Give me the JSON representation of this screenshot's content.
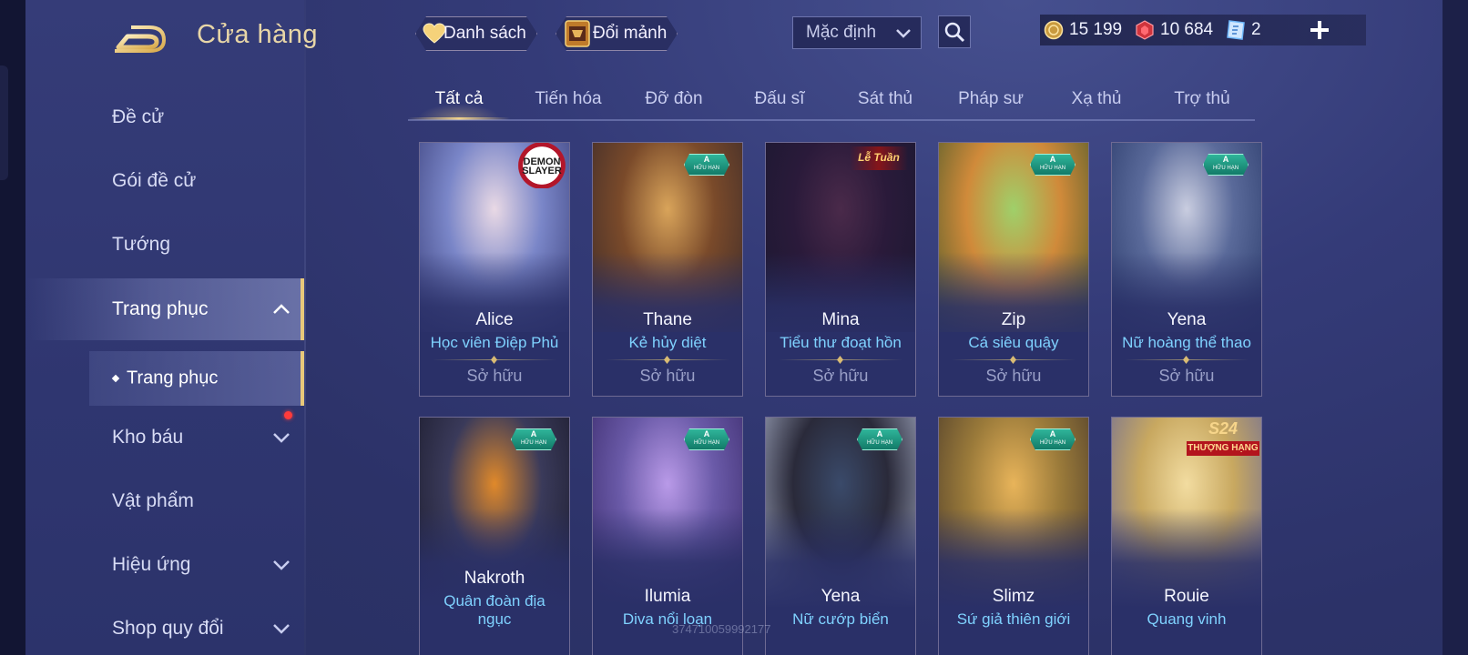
{
  "header": {
    "title": "Cửa hàng",
    "wishlist_label": "Danh sách",
    "exchange_label": "Đổi mảnh",
    "sort_selected": "Mặc định"
  },
  "currencies": [
    {
      "icon": "gold-coin-icon",
      "value": "15 199"
    },
    {
      "icon": "red-gem-icon",
      "value": "10 684"
    },
    {
      "icon": "voucher-icon",
      "value": "2"
    }
  ],
  "sidebar": {
    "items": [
      {
        "label": "Đề cử"
      },
      {
        "label": "Gói đề cử"
      },
      {
        "label": "Tướng"
      },
      {
        "label": "Trang phục"
      },
      {
        "label": "Kho báu"
      },
      {
        "label": "Vật phẩm"
      },
      {
        "label": "Hiệu ứng"
      },
      {
        "label": "Shop quy đổi"
      }
    ],
    "sub_item": "Trang phục"
  },
  "tabs": [
    "Tất cả",
    "Tiến hóa",
    "Đỡ đòn",
    "Đấu sĩ",
    "Sát thủ",
    "Pháp sư",
    "Xạ thủ",
    "Trợ thủ"
  ],
  "badges": {
    "limited_grade": "A",
    "limited_text": "HỮU HẠN",
    "demon_slayer": "DEMON SLAYER",
    "event_red": "Lễ Tuần",
    "s24_big": "S24",
    "s24_small": "THƯỢNG HẠNG"
  },
  "cards": [
    {
      "hero": "Alice",
      "skin": "Học viên Điệp Phủ",
      "status": "Sở hữu",
      "badge": "demon-slayer",
      "palette": [
        "#e9d9e5",
        "#7a86c8",
        "#3a3f7a"
      ]
    },
    {
      "hero": "Thane",
      "skin": "Kẻ hủy diệt",
      "status": "Sở hữu",
      "badge": "limited",
      "palette": [
        "#d9a45a",
        "#7a4a2a",
        "#3a2a2a"
      ]
    },
    {
      "hero": "Mina",
      "skin": "Tiểu thư đoạt hồn",
      "status": "Sở hữu",
      "badge": "event-red",
      "palette": [
        "#4a2a4a",
        "#2a1a3a",
        "#1a1830"
      ]
    },
    {
      "hero": "Zip",
      "skin": "Cá siêu quậy",
      "status": "Sở hữu",
      "badge": "limited",
      "palette": [
        "#9fd06a",
        "#d08a3a",
        "#4a5a2a"
      ]
    },
    {
      "hero": "Yena",
      "skin": "Nữ hoàng thể thao",
      "status": "Sở hữu",
      "badge": "limited",
      "palette": [
        "#c9cde0",
        "#5a6a9a",
        "#2a3a6a"
      ]
    },
    {
      "hero": "Nakroth",
      "skin": "Quân đoàn địa ngục",
      "status": "",
      "badge": "limited",
      "palette": [
        "#e0892a",
        "#3a3a5a",
        "#1a1a2a"
      ]
    },
    {
      "hero": "Ilumia",
      "skin": "Diva nổi loạn",
      "status": "",
      "badge": "limited",
      "palette": [
        "#b99ae8",
        "#6a5aa8",
        "#3a2a6a"
      ]
    },
    {
      "hero": "Yena",
      "skin": "Nữ cướp biển",
      "status": "",
      "badge": "limited",
      "palette": [
        "#3a4a6a",
        "#2a2a3a",
        "#a8b0c8"
      ]
    },
    {
      "hero": "Slimz",
      "skin": "Sứ giả thiên giới",
      "status": "",
      "badge": "limited",
      "palette": [
        "#e8b45a",
        "#9a7a3a",
        "#4a3a2a"
      ]
    },
    {
      "hero": "Rouie",
      "skin": "Quang vinh",
      "status": "",
      "badge": "s24",
      "palette": [
        "#f2dca0",
        "#c8a860",
        "#6a6a9a"
      ]
    }
  ],
  "watermark": "374710059992177"
}
